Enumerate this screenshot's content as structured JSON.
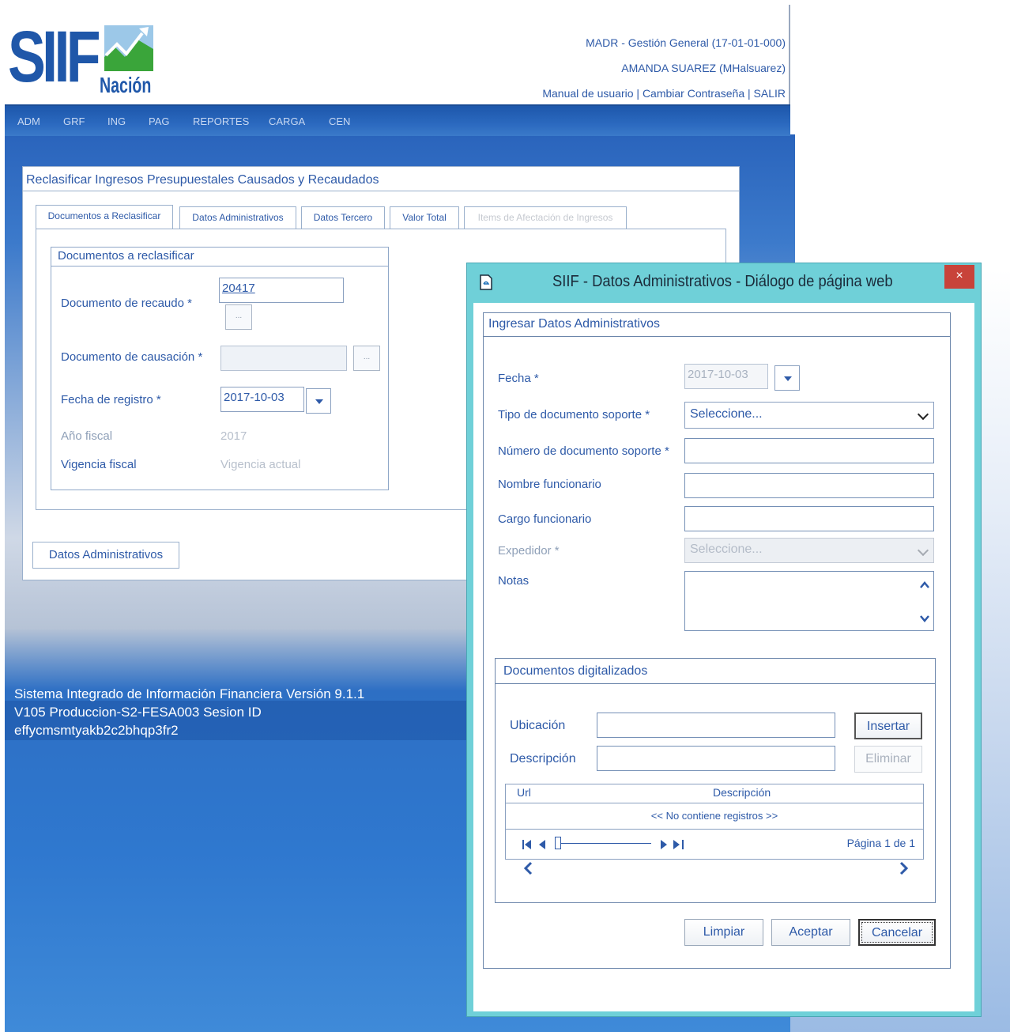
{
  "header": {
    "logo_text": "SIIF",
    "logo_sub": "Nación",
    "entity": "MADR - Gestión General (17-01-01-000)",
    "user": "AMANDA SUAREZ (MHalsuarez)",
    "links": {
      "manual": "Manual de usuario",
      "separator": "|",
      "change_password": "Cambiar Contraseña",
      "exit": "SALIR"
    }
  },
  "menu": [
    "ADM",
    "GRF",
    "ING",
    "PAG",
    "REPORTES",
    "CARGA",
    "CEN"
  ],
  "panel": {
    "title": "Reclasificar Ingresos Presupuestales Causados y Recaudados",
    "tabs": [
      {
        "label": "Documentos a Reclasificar"
      },
      {
        "label": "Datos Administrativos"
      },
      {
        "label": "Datos Tercero"
      },
      {
        "label": "Valor Total"
      },
      {
        "label": "Items de Afectación de Ingresos"
      }
    ],
    "fieldset_title": "Documentos a reclasificar",
    "fields": {
      "recaudo_label": "Documento de recaudo *",
      "recaudo_value": "20417",
      "causacion_label": "Documento de causación *",
      "fecha_label": "Fecha de registro *",
      "fecha_value": "2017-10-03",
      "anio_label": "Año fiscal",
      "anio_value": "2017",
      "vigencia_label": "Vigencia fiscal",
      "vigencia_value": "Vigencia actual"
    },
    "button_more": "...",
    "datos_admin_button": "Datos Administrativos"
  },
  "footer": {
    "line1": "Sistema Integrado de Información Financiera Versión 9.1.1",
    "line2": "V105 Produccion-S2-FESA003 Sesion ID",
    "line3": "effycmsmtyakb2c2bhqp3fr2"
  },
  "dialog": {
    "title": "SIIF - Datos Administrativos - Diálogo de página web",
    "close": "×",
    "frame_title": "Ingresar Datos Administrativos",
    "fecha_label": "Fecha *",
    "fecha_value": "2017-10-03",
    "tipo_label": "Tipo de documento soporte *",
    "tipo_value": "Seleccione...",
    "numero_label": "Número de documento soporte *",
    "nombre_label": "Nombre funcionario",
    "cargo_label": "Cargo funcionario",
    "expedidor_label": "Expedidor *",
    "expedidor_value": "Seleccione...",
    "notas_label": "Notas",
    "digitalizados": {
      "title": "Documentos digitalizados",
      "ubicacion_label": "Ubicación",
      "descripcion_label": "Descripción",
      "insertar": "Insertar",
      "eliminar": "Eliminar",
      "grid_headers": [
        "Url",
        "Descripción"
      ],
      "empty": "<< No contiene registros >>",
      "page_info": "Página 1 de 1"
    },
    "buttons": {
      "limpiar": "Limpiar",
      "aceptar": "Aceptar",
      "cancelar": "Cancelar"
    }
  },
  "colors": {
    "accent_text": "#2e5aa8",
    "menubar": "#2b69bf",
    "dialog_frame": "#6fd0d8",
    "close_button": "#c8433a"
  }
}
